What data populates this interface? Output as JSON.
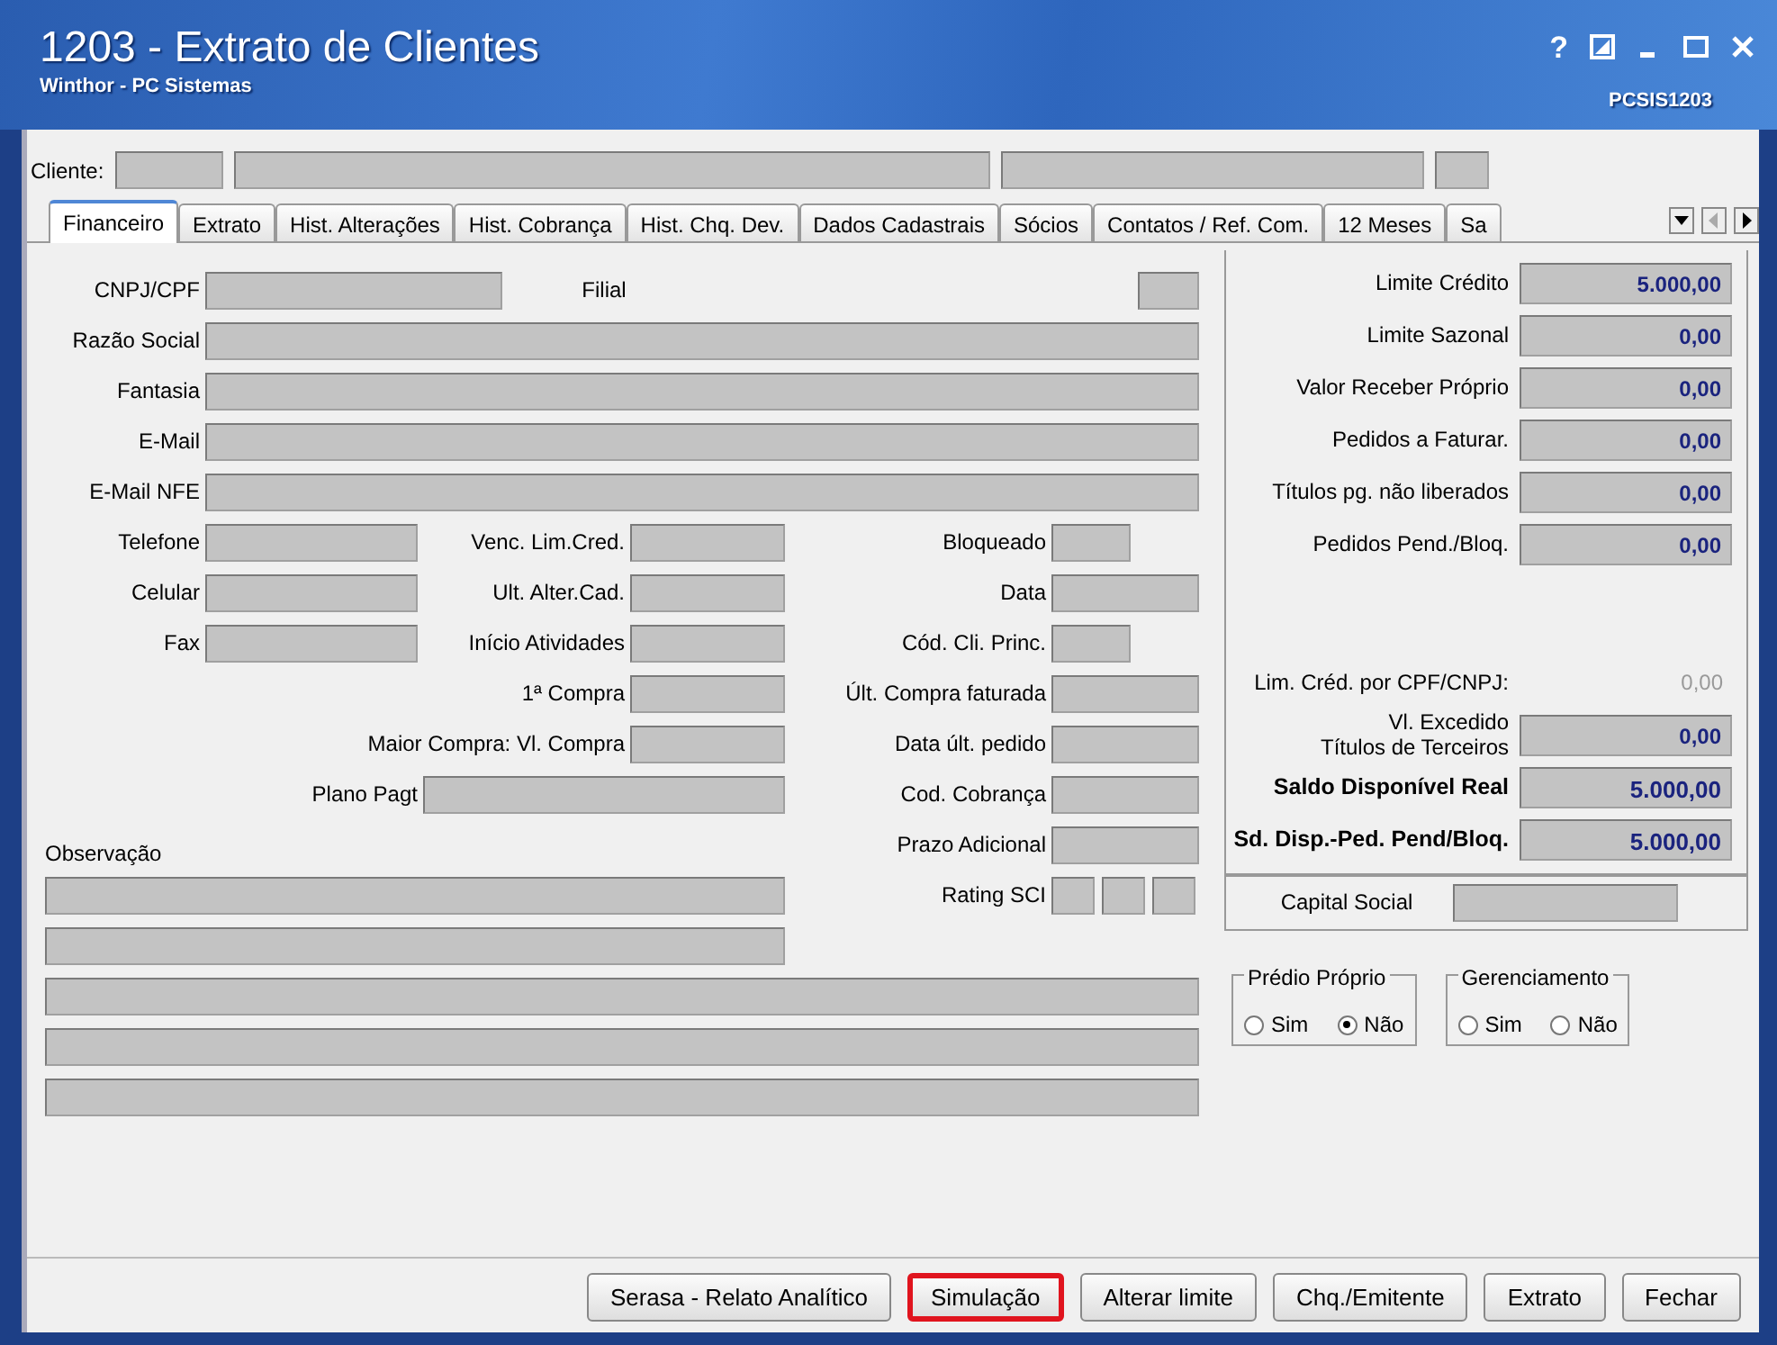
{
  "window": {
    "title": "1203 - Extrato de Clientes",
    "subtitle": "Winthor - PC Sistemas",
    "program_code": "PCSIS1203",
    "help": "?"
  },
  "client": {
    "label": "Cliente:"
  },
  "tabs": [
    {
      "label": "Financeiro",
      "selected": true
    },
    {
      "label": "Extrato",
      "selected": false
    },
    {
      "label": "Hist. Alterações",
      "selected": false
    },
    {
      "label": "Hist. Cobrança",
      "selected": false
    },
    {
      "label": "Hist. Chq. Dev.",
      "selected": false
    },
    {
      "label": "Dados Cadastrais",
      "selected": false
    },
    {
      "label": "Sócios",
      "selected": false
    },
    {
      "label": "Contatos / Ref. Com.",
      "selected": false
    },
    {
      "label": "12 Meses",
      "selected": false
    },
    {
      "label": "Sa",
      "selected": false
    }
  ],
  "form_rows": [
    [
      {
        "label": "CNPJ/CPF"
      },
      {
        "label": "Filial"
      }
    ],
    [
      {
        "label": "Razão Social"
      }
    ],
    [
      {
        "label": "Fantasia"
      }
    ],
    [
      {
        "label": "E-Mail"
      }
    ],
    [
      {
        "label": "E-Mail NFE"
      }
    ],
    [
      {
        "label": "Telefone"
      },
      {
        "label": "Venc. Lim.Cred."
      },
      {
        "label": "Bloqueado"
      }
    ],
    [
      {
        "label": "Celular"
      },
      {
        "label": "Ult. Alter.Cad."
      },
      {
        "label": "Data"
      }
    ],
    [
      {
        "label": "Fax"
      },
      {
        "label": "Início Atividades"
      },
      {
        "label": "Cód. Cli. Princ."
      }
    ],
    [
      {
        "label": "1ª Compra"
      },
      {
        "label": "Últ. Compra faturada"
      }
    ],
    [
      {
        "label": "Maior Compra: Vl. Compra"
      },
      {
        "label": "Data últ. pedido"
      }
    ],
    [
      {
        "label": "Plano Pagt"
      },
      {
        "label": "Cod. Cobrança"
      }
    ],
    [
      {
        "label": "Observação"
      },
      {
        "label": "Prazo Adicional"
      }
    ],
    [
      {
        "label": "Rating SCI"
      }
    ]
  ],
  "credit": [
    {
      "kind": "field",
      "label_lines": [
        "Limite Crédito"
      ],
      "value": "5.000,00"
    },
    {
      "kind": "field",
      "label_lines": [
        "Limite Sazonal"
      ],
      "value": "0,00"
    },
    {
      "kind": "field",
      "label_lines": [
        "Valor Receber Próprio"
      ],
      "value": "0,00"
    },
    {
      "kind": "field",
      "label_lines": [
        "Pedidos a Faturar."
      ],
      "value": "0,00"
    },
    {
      "kind": "field",
      "label_lines": [
        "Títulos pg. não liberados"
      ],
      "value": "0,00"
    },
    {
      "kind": "field",
      "label_lines": [
        "Pedidos Pend./Bloq."
      ],
      "value": "0,00"
    },
    {
      "kind": "plain",
      "label_lines": [
        "Lim. Créd. por CPF/CNPJ:"
      ],
      "value": "0,00"
    },
    {
      "kind": "field",
      "label_lines": [
        "Vl. Excedido",
        "Títulos de Terceiros"
      ],
      "value": "0,00"
    },
    {
      "kind": "total",
      "label_lines": [
        "Saldo Disponível Real"
      ],
      "value": "5.000,00"
    },
    {
      "kind": "total",
      "label_lines": [
        "Sd. Disp.-Ped. Pend/Bloq."
      ],
      "value": "5.000,00"
    }
  ],
  "capital": {
    "label": "Capital Social"
  },
  "radio_groups": [
    {
      "title": "Prédio Próprio",
      "options": [
        {
          "label": "Sim",
          "selected": false
        },
        {
          "label": "Não",
          "selected": true
        }
      ]
    },
    {
      "title": "Gerenciamento",
      "options": [
        {
          "label": "Sim",
          "selected": false
        },
        {
          "label": "Não",
          "selected": false
        }
      ]
    }
  ],
  "buttons": [
    {
      "label": "Serasa - Relato Analítico",
      "highlighted": false
    },
    {
      "label": "Simulação",
      "highlighted": true
    },
    {
      "label": "Alterar limite",
      "highlighted": false
    },
    {
      "label": "Chq./Emitente",
      "highlighted": false
    },
    {
      "label": "Extrato",
      "highlighted": false
    },
    {
      "label": "Fechar",
      "highlighted": false
    }
  ]
}
